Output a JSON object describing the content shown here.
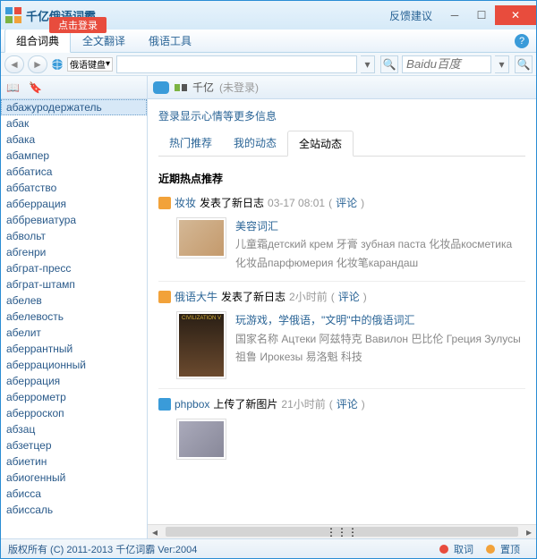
{
  "title": "千亿俄语词霸",
  "login_button": "点击登录",
  "feedback": "反馈建议",
  "main_tabs": {
    "dict": "组合词典",
    "trans": "全文翻译",
    "tools": "俄语工具"
  },
  "kbd_label": "俄语键盘",
  "baidu_placeholder": "Baidu百度",
  "header_app": "千亿",
  "header_state": "(未登录)",
  "login_info": "登录显示心情等更多信息",
  "subtabs": {
    "hot": "热门推荐",
    "mine": "我的动态",
    "site": "全站动态"
  },
  "feed_heading": "近期热点推荐",
  "words": [
    "абажуродержатель",
    "абак",
    "абака",
    "абампер",
    "аббатиса",
    "аббатство",
    "абберрация",
    "аббревиатура",
    "абвольт",
    "абгенри",
    "абграт-пресс",
    "абграт-штамп",
    "абелев",
    "абелевость",
    "абелит",
    "аберрантный",
    "аберрационный",
    "аберрация",
    "аберрометр",
    "аберроскоп",
    "абзац",
    "абзетцер",
    "абиетин",
    "абиогенный",
    "абисса",
    "абиссаль"
  ],
  "posts": [
    {
      "user": "妆妆",
      "action": "发表了新日志",
      "time": "03-17 08:01",
      "comment": "评论",
      "title": "美容词汇",
      "desc": "儿童霜детский крем 牙膏  зубная паста  化妆品косметика  化妆品парфюмерия  化妆笔карандаш"
    },
    {
      "user": "俄语大牛",
      "action": "发表了新日志",
      "time": "2小时前",
      "comment": "评论",
      "title": "玩游戏，学俄语，\"文明\"中的俄语词汇",
      "desc": "国家名称  Ацтеки 阿兹特克  Вавилон 巴比伦  Греция  Зулусы 祖鲁  Ирокезы 易洛魁  科技"
    },
    {
      "user": "phpbox",
      "action": "上传了新图片",
      "time": "21小时前",
      "comment": "评论",
      "badge": "blue"
    }
  ],
  "status": {
    "copyright": "版权所有 (C) 2011-2013 千亿词霸 Ver:2004",
    "pick": "取词",
    "options": "置顶"
  }
}
